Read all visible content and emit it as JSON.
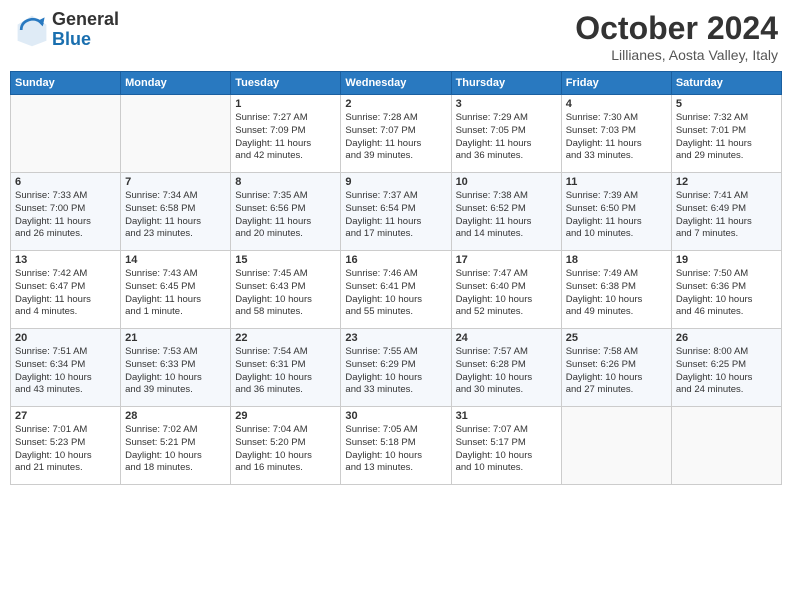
{
  "header": {
    "logo_line1": "General",
    "logo_line2": "Blue",
    "month": "October 2024",
    "location": "Lillianes, Aosta Valley, Italy"
  },
  "weekdays": [
    "Sunday",
    "Monday",
    "Tuesday",
    "Wednesday",
    "Thursday",
    "Friday",
    "Saturday"
  ],
  "weeks": [
    [
      {
        "day": "",
        "detail": ""
      },
      {
        "day": "",
        "detail": ""
      },
      {
        "day": "1",
        "detail": "Sunrise: 7:27 AM\nSunset: 7:09 PM\nDaylight: 11 hours\nand 42 minutes."
      },
      {
        "day": "2",
        "detail": "Sunrise: 7:28 AM\nSunset: 7:07 PM\nDaylight: 11 hours\nand 39 minutes."
      },
      {
        "day": "3",
        "detail": "Sunrise: 7:29 AM\nSunset: 7:05 PM\nDaylight: 11 hours\nand 36 minutes."
      },
      {
        "day": "4",
        "detail": "Sunrise: 7:30 AM\nSunset: 7:03 PM\nDaylight: 11 hours\nand 33 minutes."
      },
      {
        "day": "5",
        "detail": "Sunrise: 7:32 AM\nSunset: 7:01 PM\nDaylight: 11 hours\nand 29 minutes."
      }
    ],
    [
      {
        "day": "6",
        "detail": "Sunrise: 7:33 AM\nSunset: 7:00 PM\nDaylight: 11 hours\nand 26 minutes."
      },
      {
        "day": "7",
        "detail": "Sunrise: 7:34 AM\nSunset: 6:58 PM\nDaylight: 11 hours\nand 23 minutes."
      },
      {
        "day": "8",
        "detail": "Sunrise: 7:35 AM\nSunset: 6:56 PM\nDaylight: 11 hours\nand 20 minutes."
      },
      {
        "day": "9",
        "detail": "Sunrise: 7:37 AM\nSunset: 6:54 PM\nDaylight: 11 hours\nand 17 minutes."
      },
      {
        "day": "10",
        "detail": "Sunrise: 7:38 AM\nSunset: 6:52 PM\nDaylight: 11 hours\nand 14 minutes."
      },
      {
        "day": "11",
        "detail": "Sunrise: 7:39 AM\nSunset: 6:50 PM\nDaylight: 11 hours\nand 10 minutes."
      },
      {
        "day": "12",
        "detail": "Sunrise: 7:41 AM\nSunset: 6:49 PM\nDaylight: 11 hours\nand 7 minutes."
      }
    ],
    [
      {
        "day": "13",
        "detail": "Sunrise: 7:42 AM\nSunset: 6:47 PM\nDaylight: 11 hours\nand 4 minutes."
      },
      {
        "day": "14",
        "detail": "Sunrise: 7:43 AM\nSunset: 6:45 PM\nDaylight: 11 hours\nand 1 minute."
      },
      {
        "day": "15",
        "detail": "Sunrise: 7:45 AM\nSunset: 6:43 PM\nDaylight: 10 hours\nand 58 minutes."
      },
      {
        "day": "16",
        "detail": "Sunrise: 7:46 AM\nSunset: 6:41 PM\nDaylight: 10 hours\nand 55 minutes."
      },
      {
        "day": "17",
        "detail": "Sunrise: 7:47 AM\nSunset: 6:40 PM\nDaylight: 10 hours\nand 52 minutes."
      },
      {
        "day": "18",
        "detail": "Sunrise: 7:49 AM\nSunset: 6:38 PM\nDaylight: 10 hours\nand 49 minutes."
      },
      {
        "day": "19",
        "detail": "Sunrise: 7:50 AM\nSunset: 6:36 PM\nDaylight: 10 hours\nand 46 minutes."
      }
    ],
    [
      {
        "day": "20",
        "detail": "Sunrise: 7:51 AM\nSunset: 6:34 PM\nDaylight: 10 hours\nand 43 minutes."
      },
      {
        "day": "21",
        "detail": "Sunrise: 7:53 AM\nSunset: 6:33 PM\nDaylight: 10 hours\nand 39 minutes."
      },
      {
        "day": "22",
        "detail": "Sunrise: 7:54 AM\nSunset: 6:31 PM\nDaylight: 10 hours\nand 36 minutes."
      },
      {
        "day": "23",
        "detail": "Sunrise: 7:55 AM\nSunset: 6:29 PM\nDaylight: 10 hours\nand 33 minutes."
      },
      {
        "day": "24",
        "detail": "Sunrise: 7:57 AM\nSunset: 6:28 PM\nDaylight: 10 hours\nand 30 minutes."
      },
      {
        "day": "25",
        "detail": "Sunrise: 7:58 AM\nSunset: 6:26 PM\nDaylight: 10 hours\nand 27 minutes."
      },
      {
        "day": "26",
        "detail": "Sunrise: 8:00 AM\nSunset: 6:25 PM\nDaylight: 10 hours\nand 24 minutes."
      }
    ],
    [
      {
        "day": "27",
        "detail": "Sunrise: 7:01 AM\nSunset: 5:23 PM\nDaylight: 10 hours\nand 21 minutes."
      },
      {
        "day": "28",
        "detail": "Sunrise: 7:02 AM\nSunset: 5:21 PM\nDaylight: 10 hours\nand 18 minutes."
      },
      {
        "day": "29",
        "detail": "Sunrise: 7:04 AM\nSunset: 5:20 PM\nDaylight: 10 hours\nand 16 minutes."
      },
      {
        "day": "30",
        "detail": "Sunrise: 7:05 AM\nSunset: 5:18 PM\nDaylight: 10 hours\nand 13 minutes."
      },
      {
        "day": "31",
        "detail": "Sunrise: 7:07 AM\nSunset: 5:17 PM\nDaylight: 10 hours\nand 10 minutes."
      },
      {
        "day": "",
        "detail": ""
      },
      {
        "day": "",
        "detail": ""
      }
    ]
  ]
}
